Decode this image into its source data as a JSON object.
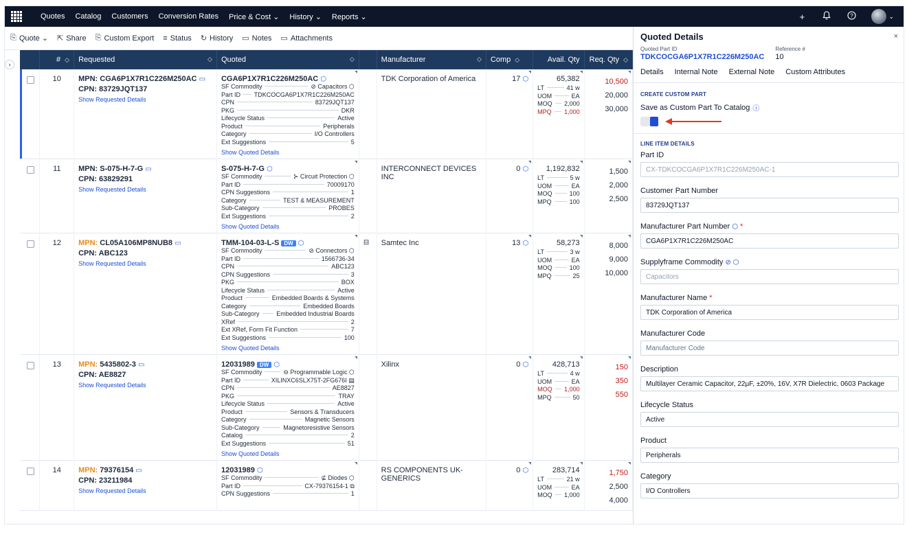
{
  "nav": {
    "items": [
      "Quotes",
      "Catalog",
      "Customers",
      "Conversion Rates",
      "Price & Cost ⌄",
      "History ⌄",
      "Reports ⌄"
    ],
    "icons": [
      "plus-icon",
      "bell-icon",
      "help-icon",
      "avatar"
    ]
  },
  "toolbar": {
    "quote": "Quote ⌄",
    "share": "Share",
    "custom_export": "Custom Export",
    "status": "Status",
    "history": "History",
    "notes": "Notes",
    "attachments": "Attachments"
  },
  "table": {
    "headers": {
      "num": "#",
      "requested": "Requested",
      "quoted": "Quoted",
      "manufacturer": "Manufacturer",
      "comp": "Comp",
      "avail": "Avail. Qty",
      "req": "Req. Qty"
    },
    "show_requested": "Show Requested Details",
    "show_quoted": "Show Quoted Details",
    "rows": [
      {
        "idx": "10",
        "mpn_label": "MPN:",
        "mpn": "CGA6P1X7R1C226M250AC",
        "mpn_orange": false,
        "cpn": "CPN: 83729JQT137",
        "quoted_title": "CGA6P1X7R1C226M250AC",
        "dw": "",
        "specs": [
          [
            "SF Commodity",
            "⊘ Capacitors ⬡"
          ],
          [
            "Part ID",
            "TDKCOCGA6P1X7R1C226M250AC"
          ],
          [
            "CPN",
            "83729JQT137"
          ],
          [
            "PKG",
            "DKR"
          ],
          [
            "Lifecycle Status",
            "Active"
          ],
          [
            "Product",
            "Peripherals"
          ],
          [
            "Category",
            "I/O Controllers"
          ],
          [
            "Ext Suggestions",
            "5"
          ]
        ],
        "manufacturer": "TDK Corporation of America",
        "comp": "17",
        "avail": "65,382",
        "avail_specs": [
          [
            "LT",
            "41 w",
            false
          ],
          [
            "UOM",
            "EA",
            false
          ],
          [
            "MOQ",
            "2,000",
            false
          ],
          [
            "MPQ",
            "1,000",
            true
          ]
        ],
        "req": [
          [
            "10,500",
            true
          ],
          [
            "20,000",
            false
          ],
          [
            "30,000",
            false
          ]
        ]
      },
      {
        "idx": "11",
        "mpn_label": "MPN:",
        "mpn": "S-075-H-7-G",
        "mpn_orange": false,
        "cpn": "CPN: 63829291",
        "quoted_title": "S-075-H-7-G",
        "dw": "",
        "specs": [
          [
            "SF Commodity",
            "⊱ Circuit Protection ⬡"
          ],
          [
            "Part ID",
            "70009170"
          ],
          [
            "CPN Suggestions",
            "1"
          ],
          [
            "Category",
            "TEST & MEASUREMENT"
          ],
          [
            "Sub-Category",
            "PROBES"
          ],
          [
            "Ext Suggestions",
            "2"
          ]
        ],
        "manufacturer": "INTERCONNECT DEVICES INC",
        "comp": "0",
        "avail": "1,192,832",
        "avail_specs": [
          [
            "LT",
            "5 w",
            false
          ],
          [
            "UOM",
            "EA",
            false
          ],
          [
            "MOQ",
            "100",
            false
          ],
          [
            "MPQ",
            "100",
            false
          ]
        ],
        "req": [
          [
            "1,500",
            false
          ],
          [
            "2,000",
            false
          ],
          [
            "2,500",
            false
          ]
        ]
      },
      {
        "idx": "12",
        "mpn_label": "MPN:",
        "mpn": "CL05A106MP8NUB8",
        "mpn_orange": true,
        "cpn": "CPN: ABC123",
        "quoted_title": "TMM-104-03-L-S",
        "dw": "DW",
        "specs": [
          [
            "SF Commodity",
            "⊘ Connectors ⬡"
          ],
          [
            "Part ID",
            "1566736-34"
          ],
          [
            "CPN",
            "ABC123"
          ],
          [
            "CPN Suggestions",
            "3"
          ],
          [
            "PKG",
            "BOX"
          ],
          [
            "Lifecycle Status",
            "Active"
          ],
          [
            "Product",
            "Embedded Boards & Systems"
          ],
          [
            "Category",
            "Embedded Boards"
          ],
          [
            "Sub-Category",
            "Embedded Industrial Boards"
          ],
          [
            "XRef",
            "2"
          ],
          [
            "Ext XRef, Form Fit Function",
            "7"
          ],
          [
            "Ext Suggestions",
            "100"
          ]
        ],
        "manufacturer": "Samtec Inc",
        "comp": "13",
        "avail": "58,273",
        "avail_specs": [
          [
            "LT",
            "3 w",
            false
          ],
          [
            "UOM",
            "EA",
            false
          ],
          [
            "MOQ",
            "100",
            false
          ],
          [
            "MPQ",
            "25",
            false
          ]
        ],
        "req": [
          [
            "8,000",
            false
          ],
          [
            "9,000",
            false
          ],
          [
            "10,000",
            false
          ]
        ]
      },
      {
        "idx": "13",
        "mpn_label": "MPN:",
        "mpn": "5435802-3",
        "mpn_orange": true,
        "cpn": "CPN: AE8827",
        "quoted_title": "12031989",
        "dw": "DW",
        "specs": [
          [
            "SF Commodity",
            "⊖ Programmable Logic ⬡"
          ],
          [
            "Part ID",
            "XILINXC6SLX75T-2FG676I ▤"
          ],
          [
            "CPN",
            "AE8827"
          ],
          [
            "PKG",
            "TRAY"
          ],
          [
            "Lifecycle Status",
            "Active"
          ],
          [
            "Product",
            "Sensors & Transducers"
          ],
          [
            "Category",
            "Magnetic Sensors"
          ],
          [
            "Sub-Category",
            "Magnetoresistive Sensors"
          ],
          [
            "Catalog",
            "2"
          ],
          [
            "Ext Suggestions",
            "51"
          ]
        ],
        "manufacturer": "Xilinx",
        "comp": "0",
        "avail": "428,713",
        "avail_specs": [
          [
            "LT",
            "4 w",
            false
          ],
          [
            "UOM",
            "EA",
            false
          ],
          [
            "MOQ",
            "1,000",
            true
          ],
          [
            "MPQ",
            "50",
            false
          ]
        ],
        "req": [
          [
            "150",
            true
          ],
          [
            "350",
            true
          ],
          [
            "550",
            true
          ]
        ]
      },
      {
        "idx": "14",
        "mpn_label": "MPN:",
        "mpn": "79376154",
        "mpn_orange": true,
        "cpn": "CPN: 23211984",
        "quoted_title": "12031989",
        "dw": "",
        "specs": [
          [
            "SF Commodity",
            "⊈ Diodes ⬡"
          ],
          [
            "Part ID",
            "CX-79376154-1 ⧉"
          ],
          [
            "CPN Suggestions",
            "1"
          ]
        ],
        "manufacturer": "RS COMPONENTS UK-GENERICS",
        "comp": "0",
        "avail": "283,714",
        "avail_specs": [
          [
            "LT",
            "21 w",
            false
          ],
          [
            "UOM",
            "EA",
            false
          ],
          [
            "MOQ",
            "1,000",
            false
          ]
        ],
        "req": [
          [
            "1,750",
            true
          ],
          [
            "2,500",
            false
          ],
          [
            "4,000",
            false
          ]
        ]
      }
    ]
  },
  "panel": {
    "title": "Quoted Details",
    "close": "×",
    "quoted_part_id_label": "Quoted Part ID",
    "quoted_part_id": "TDKCOCGA6P1X7R1C226M250AC",
    "reference_label": "Reference #",
    "reference": "10",
    "tabs": [
      "Details",
      "Internal Note",
      "External Note",
      "Custom Attributes"
    ],
    "create_custom_title": "CREATE CUSTOM PART",
    "save_custom_label": "Save as Custom Part To Catalog",
    "line_item_title": "LINE ITEM DETAILS",
    "fields": [
      {
        "label": "Part ID",
        "value": "CX-TDKCOCGA6P1X7R1C226M250AC-1",
        "style": "disabled",
        "req": false,
        "icon": ""
      },
      {
        "label": "Customer Part Number",
        "value": "83729JQT137",
        "style": "",
        "req": false,
        "icon": ""
      },
      {
        "label": "Manufacturer Part Number",
        "value": "CGA6P1X7R1C226M250AC",
        "style": "",
        "req": true,
        "icon": "⬡"
      },
      {
        "label": "Supplyframe Commodity",
        "value": "Capacitors",
        "style": "disabled",
        "req": false,
        "icon": "⊘ ⬡"
      },
      {
        "label": "Manufacturer Name",
        "value": "TDK Corporation of America",
        "style": "",
        "req": true,
        "icon": ""
      },
      {
        "label": "Manufacturer Code",
        "value": "Manufacturer Code",
        "style": "ph",
        "req": false,
        "icon": ""
      },
      {
        "label": "Description",
        "value": "Multilayer Ceramic Capacitor, 22µF, ±20%, 16V, X7R Dielectric, 0603 Package",
        "style": "",
        "req": false,
        "icon": ""
      },
      {
        "label": "Lifecycle Status",
        "value": "Active",
        "style": "",
        "req": false,
        "icon": ""
      },
      {
        "label": "Product",
        "value": "Peripherals",
        "style": "",
        "req": false,
        "icon": ""
      },
      {
        "label": "Category",
        "value": "I/O Controllers",
        "style": "",
        "req": false,
        "icon": ""
      }
    ]
  },
  "colors": {
    "nav_bg": "#0e1729",
    "header_bg": "#1f3a5f",
    "link": "#1d4ed8",
    "orange": "#ea8a19",
    "red": "#b91c1c",
    "arrow": "#e03a1e"
  }
}
